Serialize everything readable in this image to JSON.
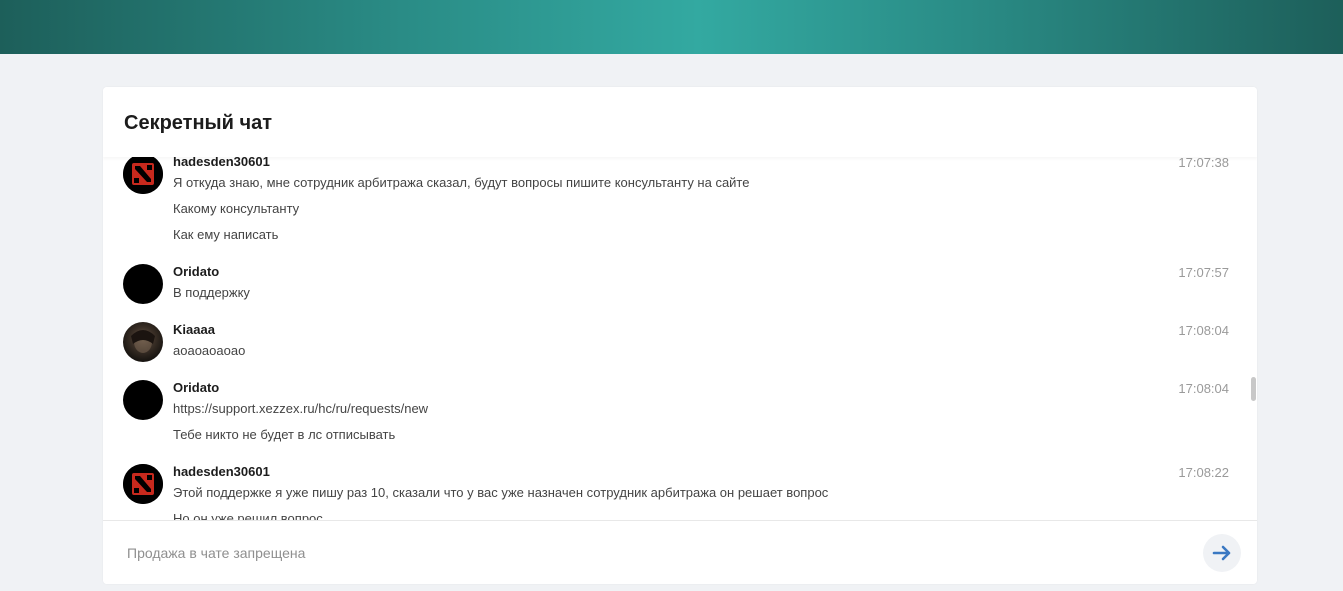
{
  "chat": {
    "title": "Секретный чат",
    "messages": [
      {
        "author": "hadesden30601",
        "time": "17:07:38",
        "avatar": "dota-logo-icon",
        "lines": [
          "Я откуда знаю, мне сотрудник арбитража сказал, будут вопросы пишите консультанту на сайте",
          "Какому консультанту",
          "Как ему написать"
        ]
      },
      {
        "author": "Oridato",
        "time": "17:07:57",
        "avatar": "black-circle-avatar",
        "lines": [
          "В поддержку"
        ]
      },
      {
        "author": "Kiaaaa",
        "time": "17:08:04",
        "avatar": "photo-avatar",
        "lines": [
          "аоаоаоаоао"
        ]
      },
      {
        "author": "Oridato",
        "time": "17:08:04",
        "avatar": "black-circle-avatar",
        "lines": [
          "https://support.xezzex.ru/hc/ru/requests/new",
          "Тебе никто не будет в лс отписывать"
        ]
      },
      {
        "author": "hadesden30601",
        "time": "17:08:22",
        "avatar": "dota-logo-icon",
        "lines": [
          "Этой поддержке я уже пишу раз 10, сказали что у вас уже назначен сотрудник арбитража он решает вопрос",
          "Но он уже решил вопрос"
        ]
      }
    ]
  },
  "composer": {
    "placeholder": "Продажа в чате запрещена",
    "send_icon": "arrow-right-icon"
  },
  "colors": {
    "header_teal": "#33a9a1",
    "send_arrow": "#3a78c2"
  }
}
